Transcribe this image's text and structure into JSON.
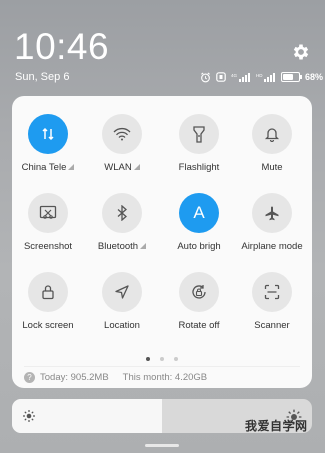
{
  "status_bar": {
    "time": "10:46",
    "date": "Sun, Sep 6",
    "battery_percent": "68",
    "battery_suffix": "%"
  },
  "tiles": [
    {
      "label": "China Tele",
      "icon": "data-transfer-icon",
      "active": true,
      "signal": true
    },
    {
      "label": "WLAN",
      "icon": "wifi-icon",
      "active": false,
      "signal": true
    },
    {
      "label": "Flashlight",
      "icon": "flashlight-icon",
      "active": false
    },
    {
      "label": "Mute",
      "icon": "bell-icon",
      "active": false
    },
    {
      "label": "Screenshot",
      "icon": "screenshot-icon",
      "active": false
    },
    {
      "label": "Bluetooth",
      "icon": "bluetooth-icon",
      "active": false,
      "signal": true
    },
    {
      "label": "Auto brigh",
      "icon": "auto-brightness-icon",
      "active": true,
      "glyph": "A"
    },
    {
      "label": "Airplane mode",
      "icon": "airplane-icon",
      "active": false
    },
    {
      "label": "Lock screen",
      "icon": "lock-icon",
      "active": false
    },
    {
      "label": "Location",
      "icon": "location-icon",
      "active": false
    },
    {
      "label": "Rotate off",
      "icon": "rotate-lock-icon",
      "active": false
    },
    {
      "label": "Scanner",
      "icon": "scanner-icon",
      "active": false
    }
  ],
  "pages": {
    "count": 3,
    "current": 1
  },
  "usage": {
    "today": "Today: 905.2MB",
    "month": "This month: 4.20GB"
  },
  "brightness": {
    "level": 0.5
  },
  "watermark": "我爱自学网",
  "colors": {
    "accent": "#1e9bf0",
    "panel": "#fafafa",
    "idle_circle": "#e6e6e6"
  }
}
